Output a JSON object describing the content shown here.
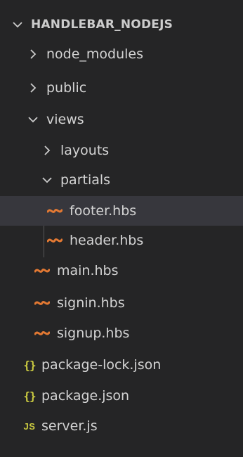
{
  "explorer": {
    "root": {
      "label": "HANDLEBAR_NODEJS",
      "expanded": true
    },
    "items": [
      {
        "label": "node_modules",
        "type": "folder",
        "expanded": false
      },
      {
        "label": "public",
        "type": "folder",
        "expanded": false
      },
      {
        "label": "views",
        "type": "folder",
        "expanded": true
      },
      {
        "label": "layouts",
        "type": "folder",
        "expanded": false
      },
      {
        "label": "partials",
        "type": "folder",
        "expanded": true
      },
      {
        "label": "footer.hbs",
        "type": "file",
        "icon": "handlebars-icon",
        "selected": true
      },
      {
        "label": "header.hbs",
        "type": "file",
        "icon": "handlebars-icon"
      },
      {
        "label": "main.hbs",
        "type": "file",
        "icon": "handlebars-icon"
      },
      {
        "label": "signin.hbs",
        "type": "file",
        "icon": "handlebars-icon"
      },
      {
        "label": "signup.hbs",
        "type": "file",
        "icon": "handlebars-icon"
      },
      {
        "label": "package-lock.json",
        "type": "file",
        "icon": "json-icon",
        "glyph": "{}"
      },
      {
        "label": "package.json",
        "type": "file",
        "icon": "json-icon",
        "glyph": "{}"
      },
      {
        "label": "server.js",
        "type": "file",
        "icon": "javascript-icon",
        "glyph": "JS"
      }
    ]
  },
  "colors": {
    "background": "#252526",
    "selected_row": "#37373d",
    "text": "#d4d4d4",
    "handlebars_icon": "#e37933",
    "json_icon": "#cbcb41",
    "js_icon": "#cbcb41",
    "indent_guide": "#585858"
  }
}
